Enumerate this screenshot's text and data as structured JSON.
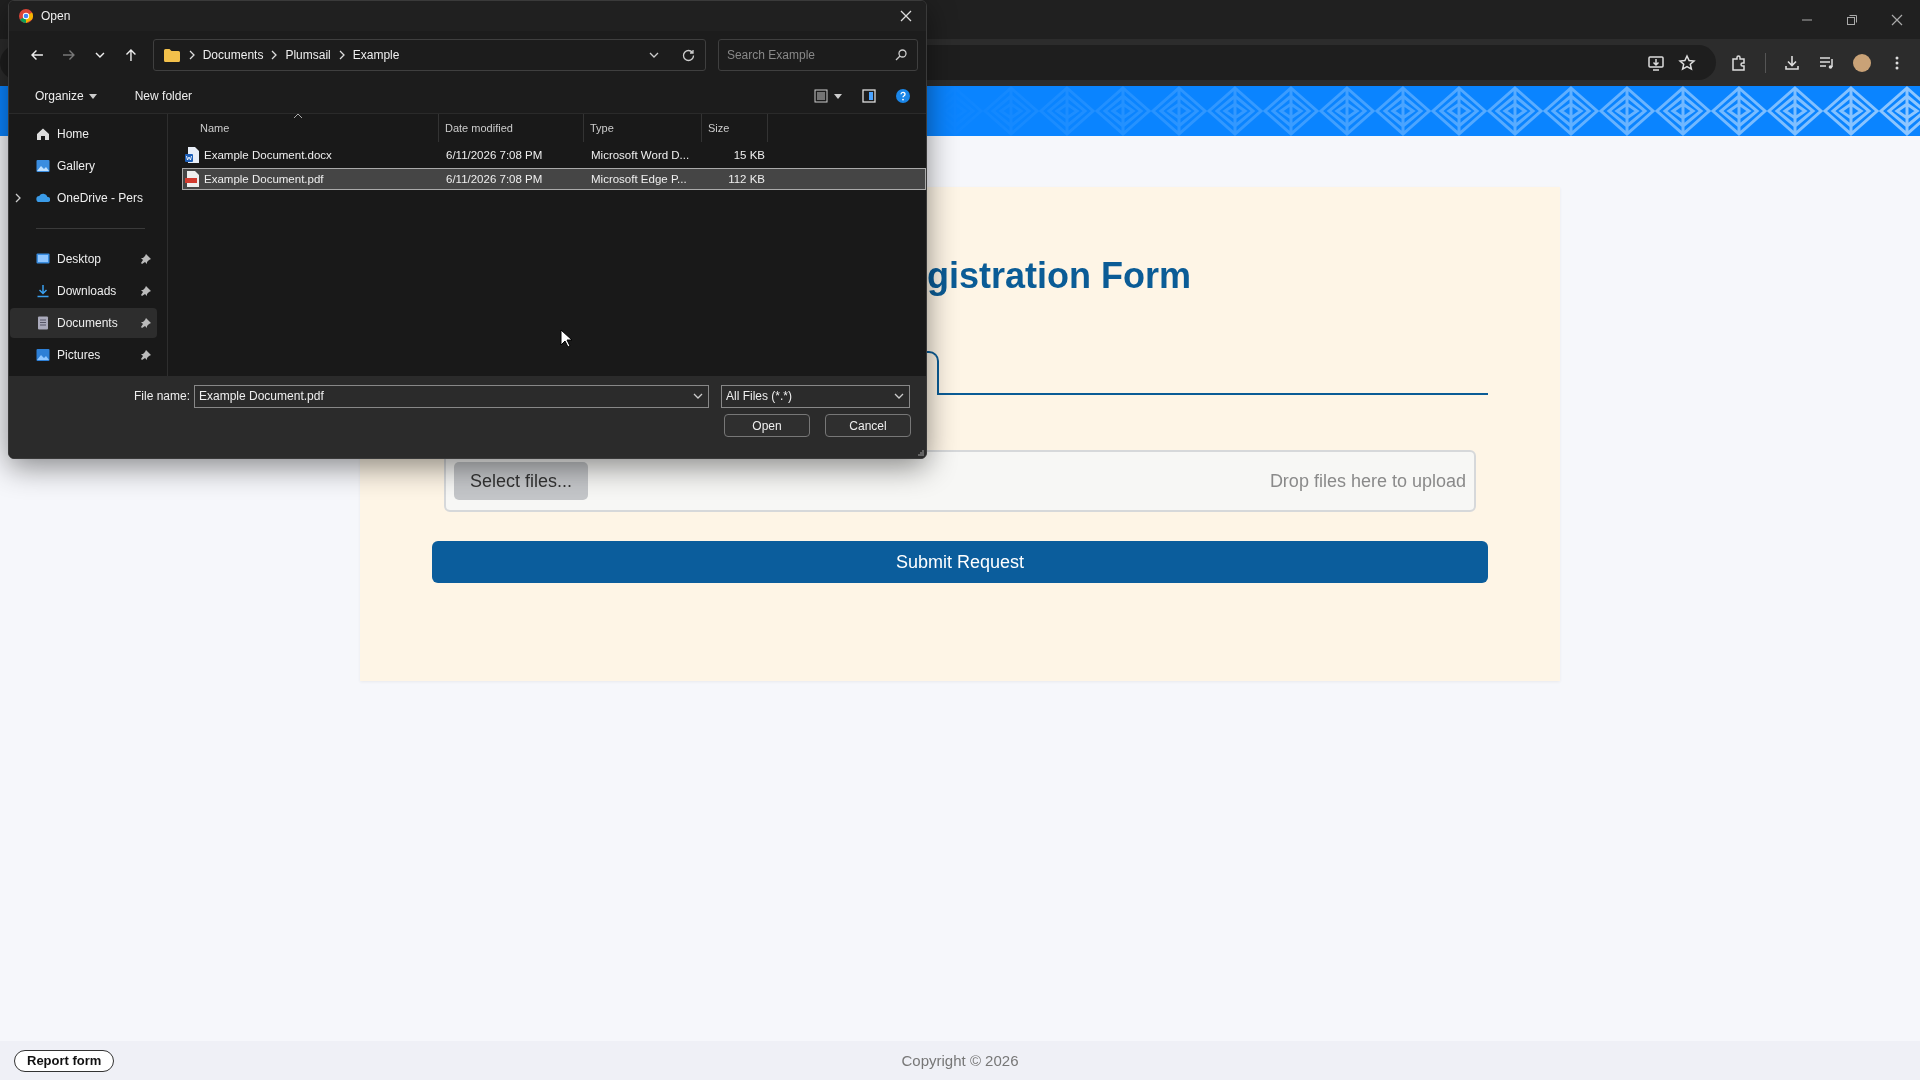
{
  "dialog": {
    "title": "Open",
    "breadcrumb": [
      "Documents",
      "Plumsail",
      "Example"
    ],
    "search_placeholder": "Search Example",
    "commands": [
      "Organize",
      "New folder"
    ],
    "locations": [
      {
        "label": "Home",
        "kind": "home",
        "expandable": false,
        "selected": false
      },
      {
        "label": "Gallery",
        "kind": "gallery",
        "expandable": false,
        "selected": false
      },
      {
        "label": "OneDrive - Pers",
        "kind": "cloud",
        "expandable": true,
        "selected": false
      }
    ],
    "quick_access": [
      {
        "label": "Desktop",
        "kind": "desktop",
        "pinned": true,
        "selected": false
      },
      {
        "label": "Downloads",
        "kind": "download",
        "pinned": true,
        "selected": false
      },
      {
        "label": "Documents",
        "kind": "documents",
        "pinned": true,
        "selected": true
      },
      {
        "label": "Pictures",
        "kind": "pictures",
        "pinned": true,
        "selected": false
      }
    ],
    "columns": [
      "Name",
      "Date modified",
      "Type",
      "Size"
    ],
    "files": [
      {
        "name": "Example Document.docx",
        "date": "6/11/2026 7:08 PM",
        "type": "Microsoft Word D...",
        "size": "15 KB",
        "kind": "word",
        "selected": false
      },
      {
        "name": "Example Document.pdf",
        "date": "6/11/2026 7:08 PM",
        "type": "Microsoft Edge P...",
        "size": "112 KB",
        "kind": "pdf",
        "selected": true
      }
    ],
    "file_name_label": "File name:",
    "file_name": "Example Document.pdf",
    "filter": "All Files (*.*)",
    "buttons": [
      "Open",
      "Cancel"
    ]
  },
  "page": {
    "heading": "gistration Form",
    "upload": {
      "button": "Select files...",
      "hint": "Drop files here to upload"
    },
    "submit": "Submit Request",
    "footer": {
      "report": "Report form",
      "copyright": "Copyright © 2026"
    }
  }
}
